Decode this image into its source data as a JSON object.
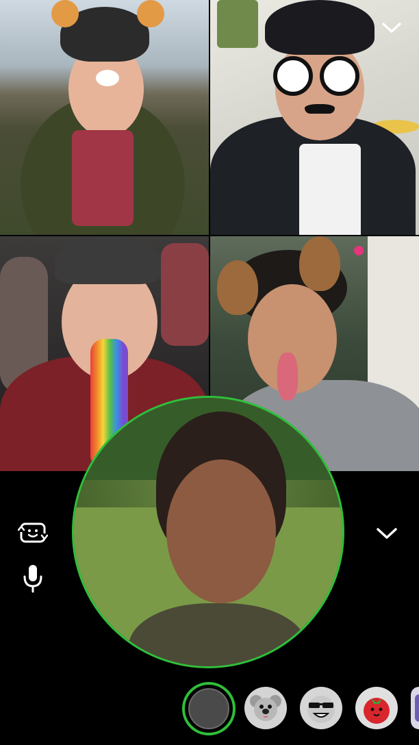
{
  "call": {
    "participants": [
      {
        "id": "participant-1",
        "lens": "deer"
      },
      {
        "id": "participant-2",
        "lens": "glasses-mustache"
      },
      {
        "id": "participant-3",
        "lens": "rainbow-tongue"
      },
      {
        "id": "participant-4",
        "lens": "bunny-ears"
      }
    ],
    "self_view_ring_color": "#2fbf3a"
  },
  "controls": {
    "flip_camera_icon": "flip-camera-icon",
    "microphone_icon": "microphone-icon",
    "collapse_icon": "chevron-down-icon",
    "minimize_icon": "chevron-down-icon"
  },
  "lens_carousel": [
    {
      "name": "capture",
      "selected": true
    },
    {
      "name": "koala"
    },
    {
      "name": "sunglasses-smiley"
    },
    {
      "name": "tomato"
    },
    {
      "name": "partial-lens"
    }
  ],
  "colors": {
    "accent": "#2fbf3a",
    "background": "#000000",
    "icon": "#ffffff"
  }
}
